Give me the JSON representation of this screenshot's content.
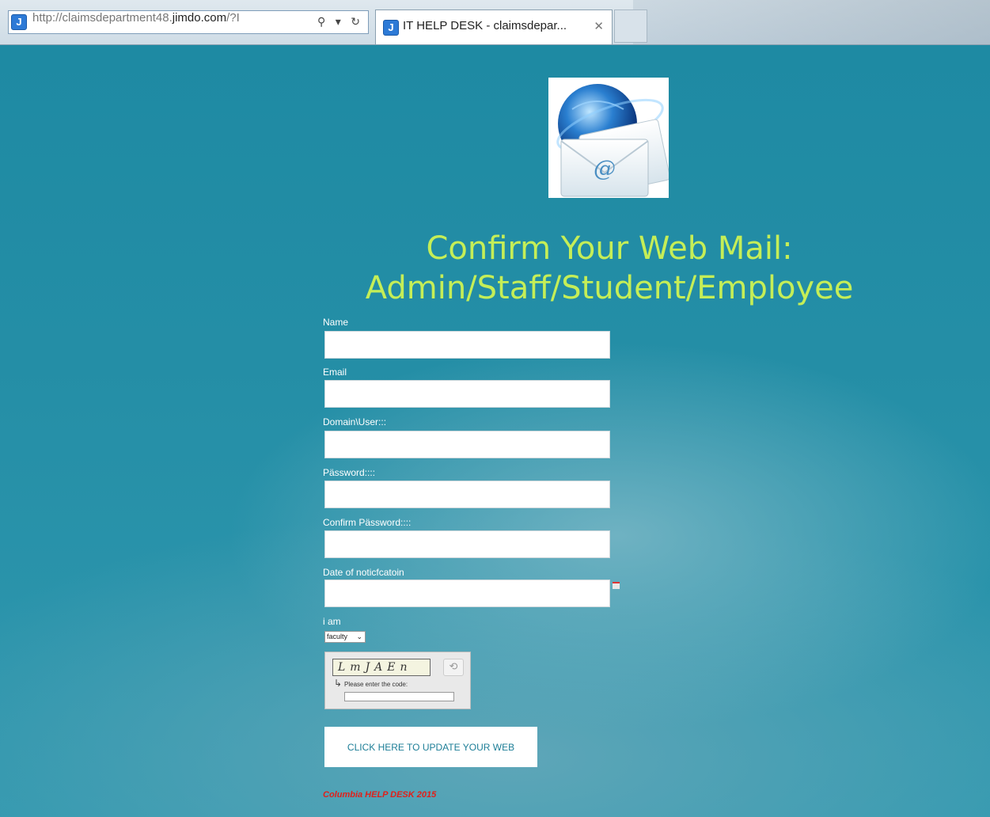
{
  "browser": {
    "url_prefix": "http://claimsdepartment48.",
    "url_domain": "jimdo.com",
    "url_suffix": "/?I",
    "search_glyph": "⚲",
    "dropdown_glyph": "▾",
    "refresh_glyph": "↻",
    "tab_icon_letter": "J",
    "tab_title": "IT HELP DESK - claimsdepar...",
    "close_glyph": "✕"
  },
  "page": {
    "headline_line1": "Confirm Your Web Mail:",
    "headline_line2": "Admin/Staff/Student/Employee",
    "fields": [
      {
        "label": "Name"
      },
      {
        "label": "Email"
      },
      {
        "label": "Domain\\User:::"
      },
      {
        "label": "Pässword::::"
      },
      {
        "label": "Confirm Pässword::::"
      },
      {
        "label": "Date of noticfcatoin"
      }
    ],
    "role_label": "i am",
    "role_selected": "faculty",
    "captcha": {
      "code": "LmJAEn",
      "prompt": "Please enter the code:"
    },
    "submit_label": "CLICK HERE TO UPDATE YOUR WEB",
    "footer": "Columbia HELP DESK 2015"
  },
  "colors": {
    "background": "#248ea6",
    "headline": "#c5ee57",
    "button_text": "#1d7e97",
    "footer_text": "#e0201a"
  },
  "icons": [
    "site-favicon-icon",
    "search-icon",
    "refresh-icon",
    "close-icon",
    "email-globe-logo",
    "calendar-icon",
    "captcha-refresh-icon"
  ]
}
